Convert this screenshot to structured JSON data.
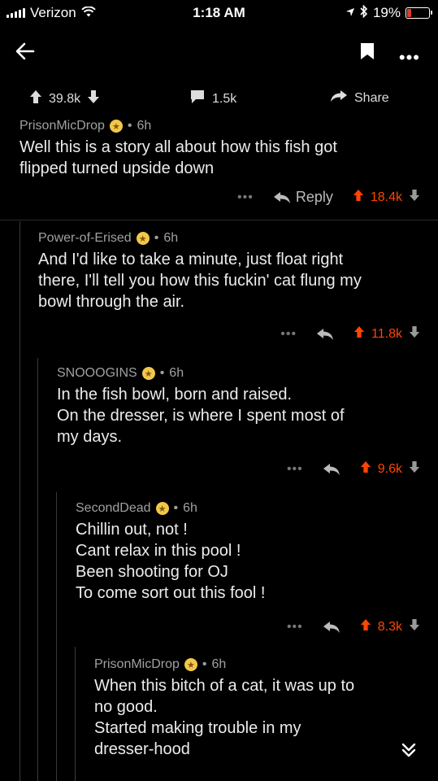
{
  "status": {
    "carrier": "Verizon",
    "time": "1:18 AM",
    "battery": "19%",
    "battery_level": 0.19,
    "battery_color": "#e03a2a"
  },
  "post": {
    "upvotes": "39.8k",
    "comments": "1.5k",
    "share_label": "Share"
  },
  "colors": {
    "accent": "#ff4500",
    "background": "#000000"
  },
  "comments": [
    {
      "author": "PrisonMicDrop",
      "age": "6h",
      "lines": [
        "Well this is a story all about how this fish got",
        "flipped turned upside down"
      ],
      "reply_label": "Reply",
      "score": "18.4k"
    },
    {
      "author": "Power-of-Erised",
      "age": "6h",
      "lines": [
        "And I'd like to take a minute, just float right",
        "there, I'll tell you how this fuckin' cat flung my",
        "bowl through the air."
      ],
      "score": "11.8k"
    },
    {
      "author": "SNOOOGINS",
      "age": "6h",
      "lines": [
        "In the fish bowl, born and raised.",
        "On the dresser, is where I spent most of",
        "my days."
      ],
      "score": "9.6k"
    },
    {
      "author": "SecondDead",
      "age": "6h",
      "lines": [
        "Chillin out, not !",
        "Cant relax in this pool !",
        "Been shooting for OJ",
        "To come sort out this fool !"
      ],
      "score": "8.3k"
    },
    {
      "author": "PrisonMicDrop",
      "age": "6h",
      "lines": [
        "When this bitch of a cat, it was up to",
        "no good.",
        "Started making trouble in my",
        "dresser-hood"
      ]
    }
  ],
  "icons": {
    "back": "arrow-left-icon",
    "bookmark": "bookmark-icon",
    "more": "more-icon",
    "collapse": "chevron-double-down-icon"
  }
}
